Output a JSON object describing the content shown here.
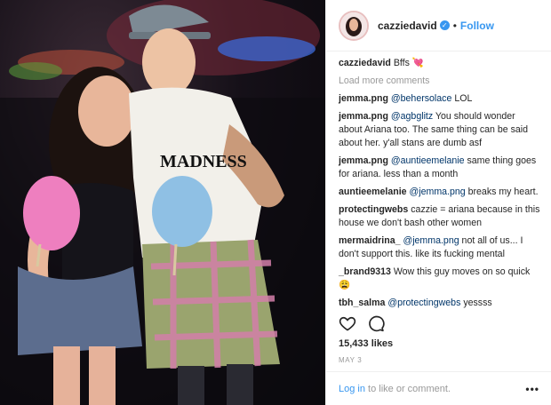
{
  "header": {
    "username": "cazziedavid",
    "verified_badge": "✓",
    "separator": "•",
    "follow_label": "Follow"
  },
  "caption": {
    "username": "cazziedavid",
    "text": "Bffs 💘"
  },
  "load_more_label": "Load more comments",
  "comments": [
    {
      "user": "jemma.png",
      "mention": "@behersolace",
      "text": " LOL"
    },
    {
      "user": "jemma.png",
      "mention": "@agbglitz",
      "text": " You should wonder about Ariana too. The same thing can be said about her. y'all stans are dumb asf"
    },
    {
      "user": "jemma.png",
      "mention": "@auntieemelanie",
      "text": " same thing goes for ariana. less than a month"
    },
    {
      "user": "auntieemelanie",
      "mention": "@jemma.png",
      "text": " breaks my heart."
    },
    {
      "user": "protectingwebs",
      "mention": "",
      "text": "cazzie = ariana because in this house we don't bash other women"
    },
    {
      "user": "mermaidrina_",
      "mention": "@jemma.png",
      "text": " not all of us... I don't support this. like its fucking mental"
    },
    {
      "user": "_brand9313",
      "mention": "",
      "text": "Wow this guy moves on so quick 😩"
    },
    {
      "user": "tbh_salma",
      "mention": "@protectingwebs",
      "text": " yessss"
    }
  ],
  "likes": "15,433 likes",
  "date": "MAY 3",
  "footer": {
    "login_label": "Log in",
    "login_suffix": " to like or comment.",
    "more_label": "•••"
  },
  "photo": {
    "shirt_text": "MADNESS"
  }
}
